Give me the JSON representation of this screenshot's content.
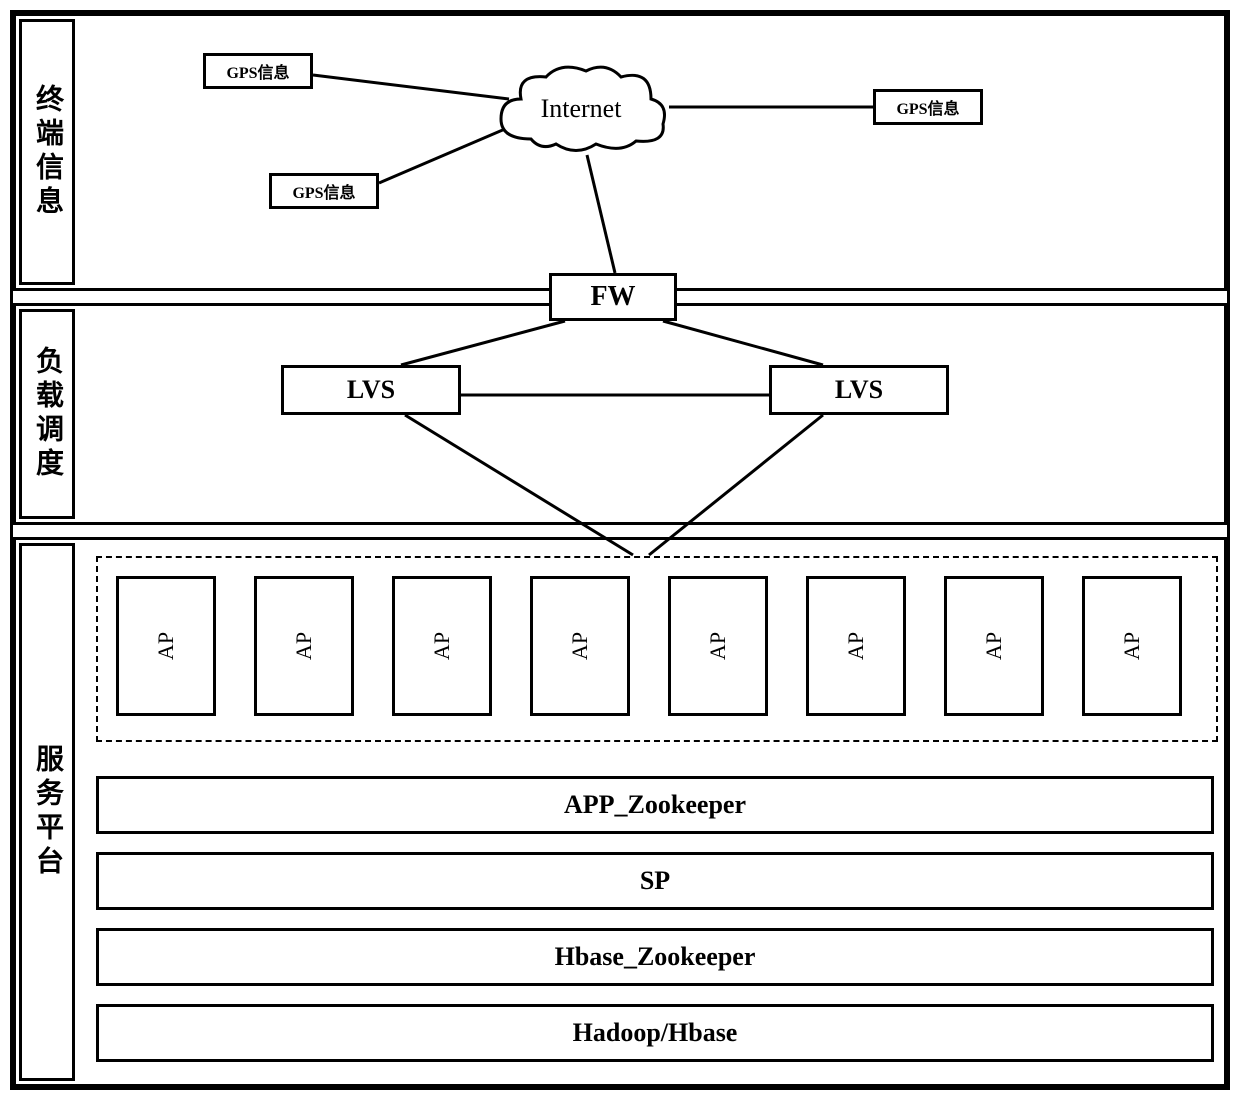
{
  "sections": {
    "terminal": {
      "label": "终端信息"
    },
    "load": {
      "label": "负载调度"
    },
    "service": {
      "label": "服务平台"
    }
  },
  "nodes": {
    "gps1": "GPS信息",
    "gps2": "GPS信息",
    "gps3": "GPS信息",
    "internet": "Internet",
    "fw": "FW",
    "lvs1": "LVS",
    "lvs2": "LVS",
    "ap": "AP",
    "bars": {
      "b1": "APP_Zookeeper",
      "b2": "SP",
      "b3": "Hbase_Zookeeper",
      "b4": "Hadoop/Hbase"
    }
  }
}
